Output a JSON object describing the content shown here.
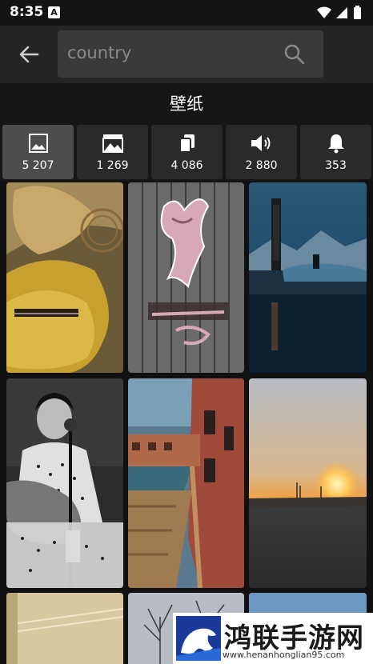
{
  "status_bar": {
    "time": "8:35",
    "notification_letter": "A"
  },
  "search": {
    "query": "country"
  },
  "section": {
    "title": "壁纸"
  },
  "categories": [
    {
      "name": "image-icon",
      "count": "5 207",
      "active": true
    },
    {
      "name": "landscape-icon",
      "count": "1 269",
      "active": false
    },
    {
      "name": "cards-icon",
      "count": "4 086",
      "active": false
    },
    {
      "name": "speaker-icon",
      "count": "2 880",
      "active": false
    },
    {
      "name": "bell-icon",
      "count": "353",
      "active": false
    }
  ],
  "wallpapers": [
    {
      "name": "wallpaper-guitar-hat"
    },
    {
      "name": "wallpaper-country-girl-logo"
    },
    {
      "name": "wallpaper-motel-night"
    },
    {
      "name": "wallpaper-woman-guitar-microphone"
    },
    {
      "name": "wallpaper-town-canal"
    },
    {
      "name": "wallpaper-sunset-field"
    },
    {
      "name": "wallpaper-beige-texture"
    },
    {
      "name": "wallpaper-winter-trees"
    },
    {
      "name": "wallpaper-blue-sky"
    }
  ],
  "watermark": {
    "title": "鸿联手游网",
    "url": "www.henanhonglian95.com"
  },
  "colors": {
    "background": "#111111",
    "toolbar": "#252525",
    "search_field": "#3a3a3a",
    "tab": "#2a2a2a",
    "tab_active": "#4d4d4d"
  }
}
